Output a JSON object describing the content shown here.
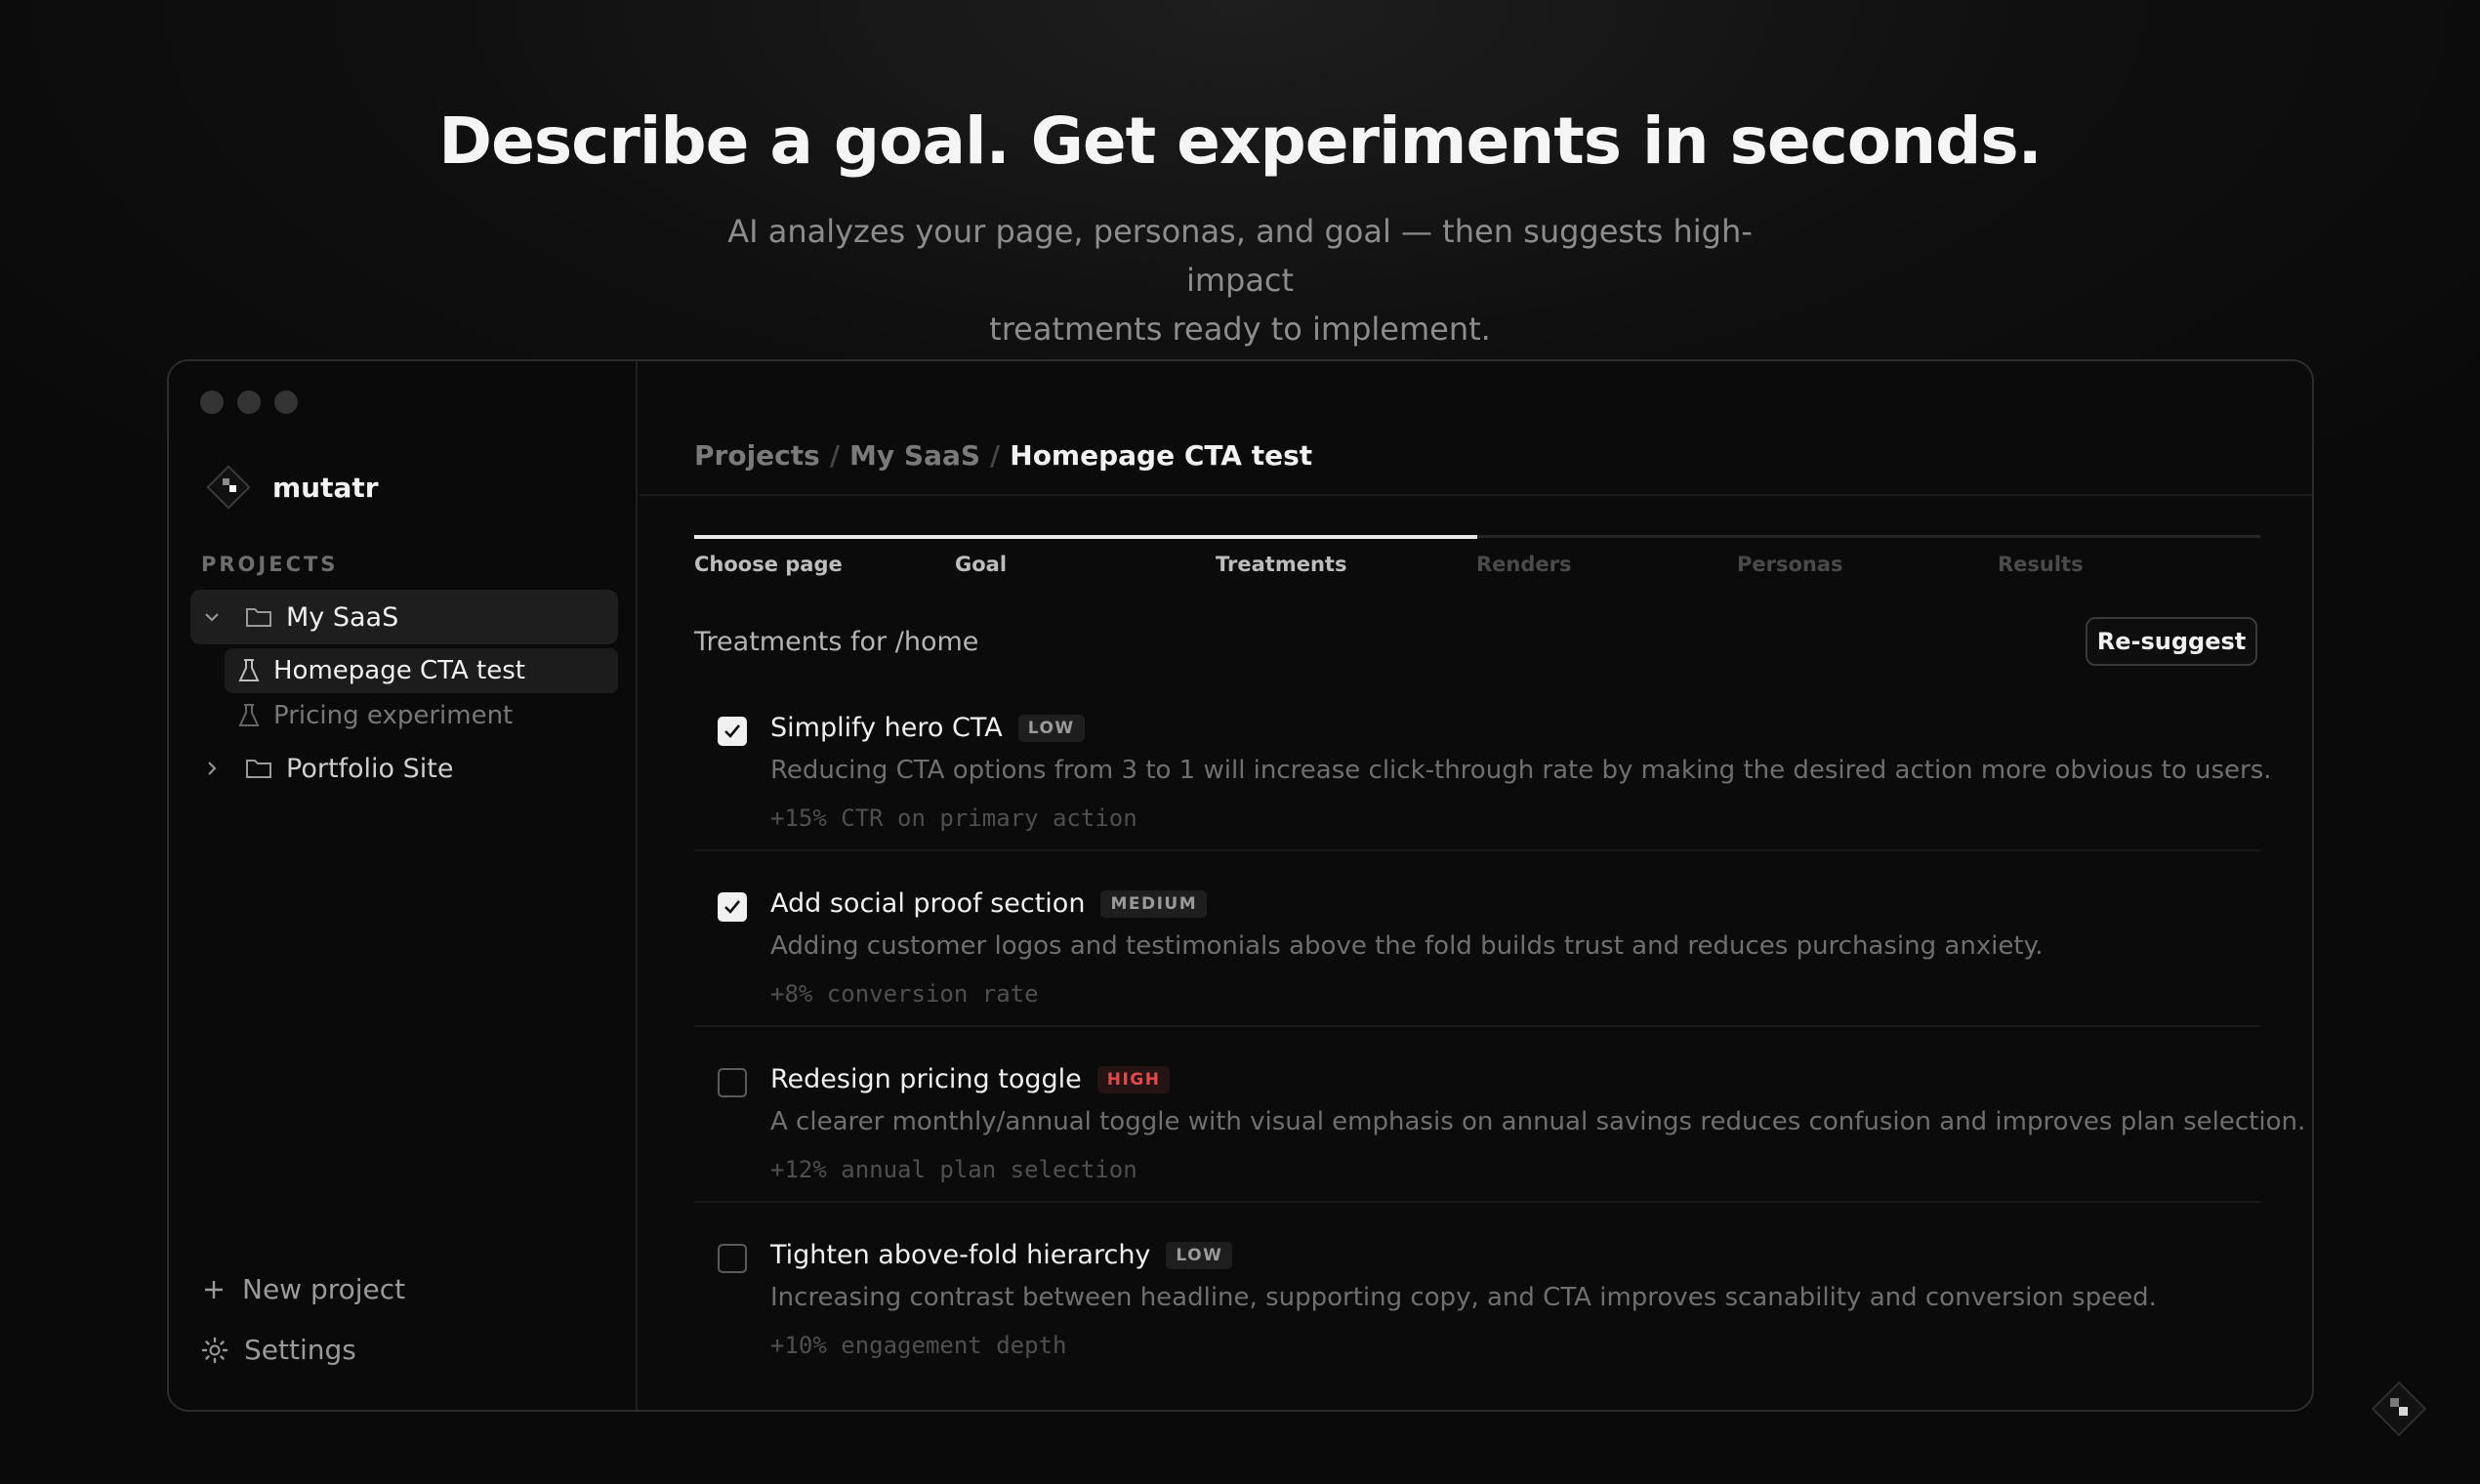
{
  "hero": {
    "title": "Describe a goal. Get experiments in seconds.",
    "subtitle_line1": "AI analyzes your page, personas, and goal — then suggests high-impact",
    "subtitle_line2": "treatments ready to implement."
  },
  "sidebar": {
    "brand": "mutatr",
    "section_label": "PROJECTS",
    "projects": [
      {
        "label": "My SaaS",
        "expanded": true
      },
      {
        "label": "Portfolio Site",
        "expanded": false
      }
    ],
    "experiments": [
      {
        "label": "Homepage CTA test",
        "active": true
      },
      {
        "label": "Pricing experiment",
        "active": false
      }
    ],
    "new_project": "New project",
    "settings": "Settings"
  },
  "breadcrumb": {
    "root": "Projects",
    "project": "My SaaS",
    "current": "Homepage CTA test",
    "separator": "/"
  },
  "steps": {
    "items": [
      "Choose page",
      "Goal",
      "Treatments",
      "Renders",
      "Personas",
      "Results"
    ],
    "completed_count": 3
  },
  "treatments": {
    "heading": "Treatments for /home",
    "resuggest_label": "Re-suggest",
    "items": [
      {
        "title": "Simplify hero CTA",
        "badge": "LOW",
        "checked": true,
        "description": "Reducing CTA options from 3 to 1 will increase click-through rate by making the desired action more obvious to users.",
        "metric": "+15% CTR on primary action"
      },
      {
        "title": "Add social proof section",
        "badge": "MEDIUM",
        "checked": true,
        "description": "Adding customer logos and testimonials above the fold builds trust and reduces purchasing anxiety.",
        "metric": "+8% conversion rate"
      },
      {
        "title": "Redesign pricing toggle",
        "badge": "HIGH",
        "checked": false,
        "description": "A clearer monthly/annual toggle with visual emphasis on annual savings reduces confusion and improves plan selection.",
        "metric": "+12% annual plan selection"
      },
      {
        "title": "Tighten above-fold hierarchy",
        "badge": "LOW",
        "checked": false,
        "description": "Increasing contrast between headline, supporting copy, and CTA improves scanability and conversion speed.",
        "metric": "+10% engagement depth"
      }
    ]
  },
  "colors": {
    "background": "#0a0a0a",
    "accent": "#f0f0f0",
    "badge_high": "#e54848"
  }
}
